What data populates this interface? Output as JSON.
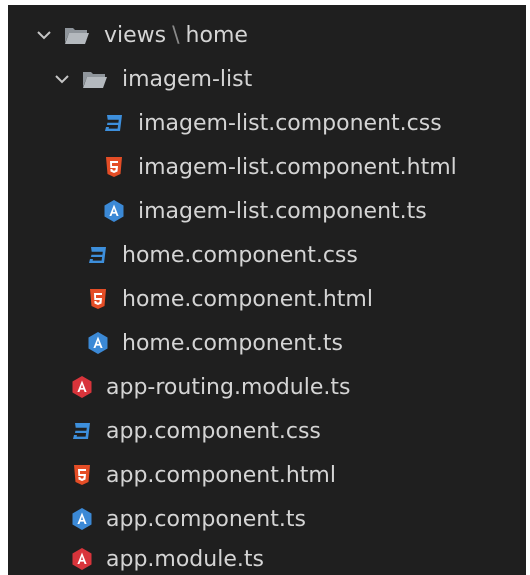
{
  "explorer": {
    "compact_folder": {
      "part1": "views",
      "separator": "\\",
      "part2": "home",
      "icon": "folder-open-icon",
      "chevron": "chevron-down-icon"
    },
    "subfolder": {
      "label": "imagem-list",
      "icon": "folder-open-icon",
      "chevron": "chevron-down-icon"
    },
    "files": [
      {
        "label": "imagem-list.component.css",
        "icon": "css-file-icon"
      },
      {
        "label": "imagem-list.component.html",
        "icon": "html-file-icon"
      },
      {
        "label": "imagem-list.component.ts",
        "icon": "angular-component-icon"
      },
      {
        "label": "home.component.css",
        "icon": "css-file-icon"
      },
      {
        "label": "home.component.html",
        "icon": "html-file-icon"
      },
      {
        "label": "home.component.ts",
        "icon": "angular-component-icon"
      },
      {
        "label": "app-routing.module.ts",
        "icon": "angular-module-icon"
      },
      {
        "label": "app.component.css",
        "icon": "css-file-icon"
      },
      {
        "label": "app.component.html",
        "icon": "html-file-icon"
      },
      {
        "label": "app.component.ts",
        "icon": "angular-component-icon"
      },
      {
        "label": "app.module.ts",
        "icon": "angular-module-icon"
      }
    ]
  },
  "colors": {
    "background": "#1f1f1f",
    "text": "#d4d4d4",
    "css_icon": "#3d8fdc",
    "html_icon": "#e44d26",
    "angular_component_icon": "#3b89d6",
    "angular_module_icon": "#d8343b",
    "folder_icon": "#9aa0a6"
  }
}
